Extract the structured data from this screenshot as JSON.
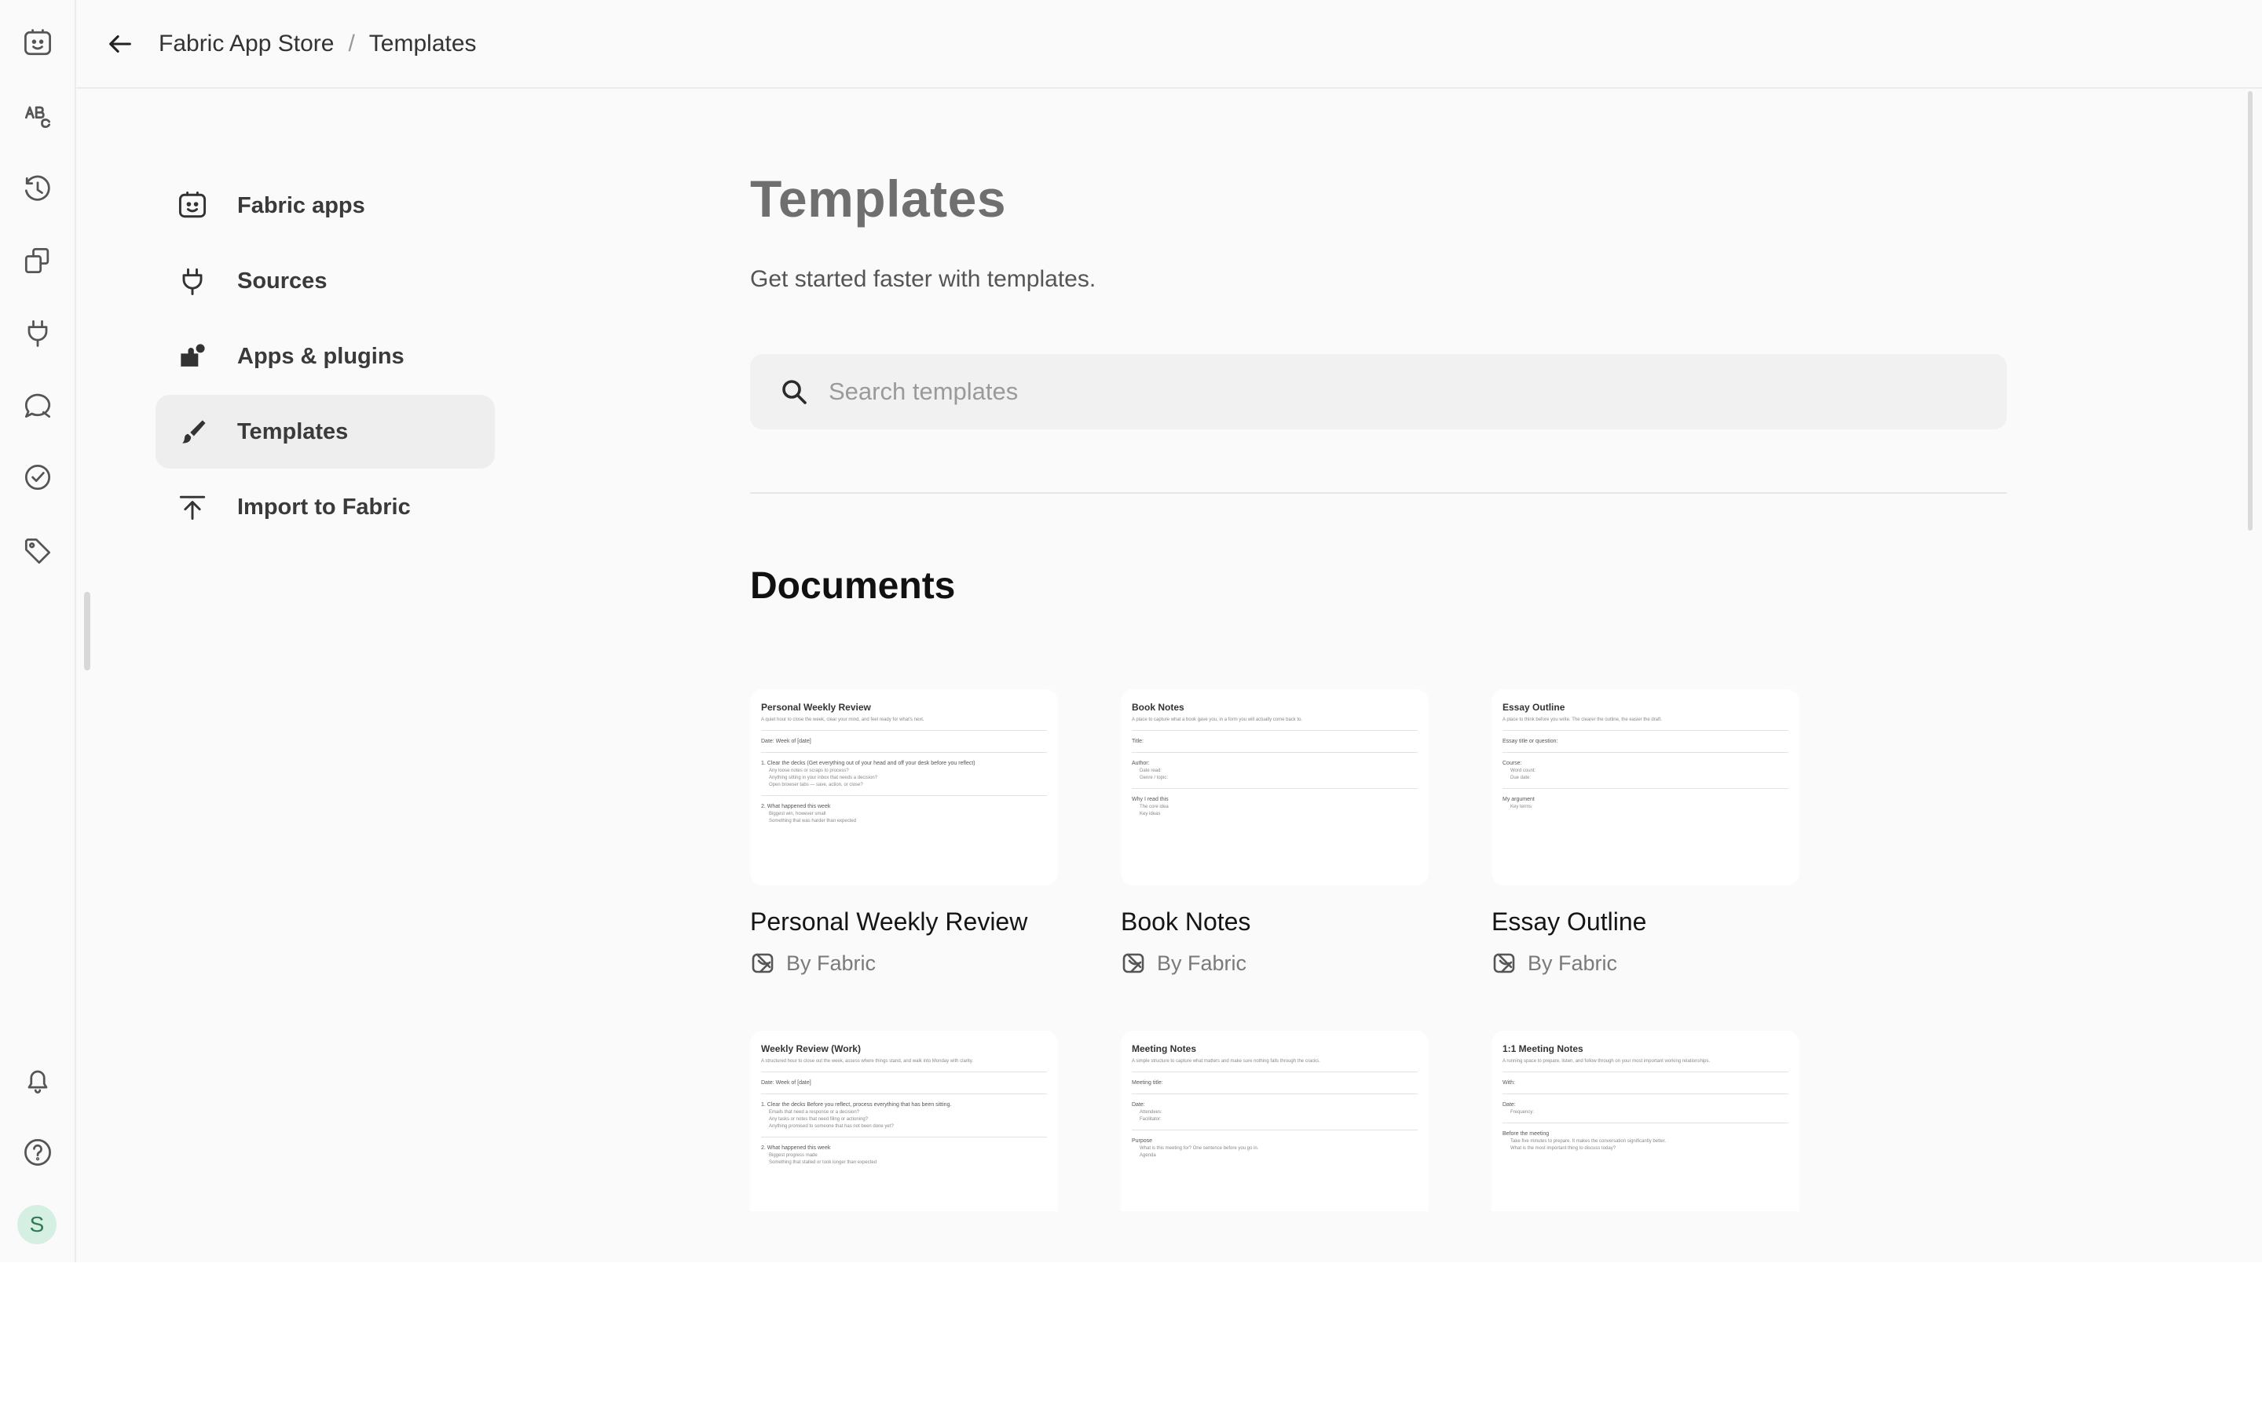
{
  "breadcrumb": {
    "parent": "Fabric App Store",
    "separator": "/",
    "current": "Templates"
  },
  "subnav": {
    "items": [
      {
        "label": "Fabric apps",
        "icon": "fabric-face-icon"
      },
      {
        "label": "Sources",
        "icon": "plug-icon"
      },
      {
        "label": "Apps & plugins",
        "icon": "apps-plugins-icon"
      },
      {
        "label": "Templates",
        "icon": "brush-icon",
        "active": true
      },
      {
        "label": "Import to Fabric",
        "icon": "upload-icon"
      }
    ]
  },
  "main": {
    "title": "Templates",
    "subtitle": "Get started faster with templates.",
    "search_placeholder": "Search templates",
    "section_title": "Documents"
  },
  "cards": [
    {
      "title": "Personal Weekly Review",
      "by": "By Fabric",
      "thumb": {
        "title": "Personal Weekly Review",
        "desc": "A quiet hour to close the week, clear your mind, and feel ready for what's next.",
        "row1": "Date: Week of [date]",
        "row2": "1. Clear the decks (Get everything out of your head and off your desk before you reflect)",
        "b1": "Any loose notes or scraps to process?",
        "b2": "Anything sitting in your inbox that needs a decision?",
        "b3": "Open browser tabs — save, action, or close?",
        "row3": "2. What happened this week",
        "b4": "Biggest win, however small",
        "b5": "Something that was harder than expected"
      }
    },
    {
      "title": "Book Notes",
      "by": "By Fabric",
      "thumb": {
        "title": "Book Notes",
        "desc": "A place to capture what a book gave you, in a form you will actually come back to.",
        "row1": "Title:",
        "row2": "Author:",
        "b1": "Date read:",
        "b2": "Genre / topic:",
        "b3": "",
        "row3": "Why I read this",
        "b4": "The core idea",
        "b5": "Key ideas"
      }
    },
    {
      "title": "Essay Outline",
      "by": "By Fabric",
      "thumb": {
        "title": "Essay Outline",
        "desc": "A place to think before you write. The clearer the outline, the easier the draft.",
        "row1": "Essay title or question:",
        "row2": "Course:",
        "b1": "Word count:",
        "b2": "Due date:",
        "b3": "",
        "row3": "My argument",
        "b4": "Key terms",
        "b5": ""
      }
    },
    {
      "title": "Weekly Review (Work)",
      "by": "By Fabric",
      "thumb": {
        "title": "Weekly Review (Work)",
        "desc": "A structured hour to close out the week, assess where things stand, and walk into Monday with clarity.",
        "row1": "Date: Week of [date]",
        "row2": "1. Clear the decks Before you reflect, process everything that has been sitting.",
        "b1": "Emails that need a response or a decision?",
        "b2": "Any tasks or notes that need filing or actioning?",
        "b3": "Anything promised to someone that has not been done yet?",
        "row3": "2. What happened this week",
        "b4": "Biggest progress made",
        "b5": "Something that stalled or took longer than expected"
      }
    },
    {
      "title": "Meeting Notes",
      "by": "By Fabric",
      "thumb": {
        "title": "Meeting Notes",
        "desc": "A simple structure to capture what matters and make sure nothing falls through the cracks.",
        "row1": "Meeting title:",
        "row2": "Date:",
        "b1": "Attendees:",
        "b2": "Facilitator:",
        "b3": "",
        "row3": "Purpose",
        "b4": "What is this meeting for? One sentence before you go in.",
        "b5": "Agenda"
      }
    },
    {
      "title": "1:1 Meeting Notes",
      "by": "By Fabric",
      "thumb": {
        "title": "1:1 Meeting Notes",
        "desc": "A running space to prepare, listen, and follow through on your most important working relationships.",
        "row1": "With:",
        "row2": "Date:",
        "b1": "Frequency:",
        "b2": "",
        "b3": "",
        "row3": "Before the meeting",
        "b4": "Take five minutes to prepare. It makes the conversation significantly better.",
        "b5": "What is the most important thing to discuss today?"
      }
    }
  ],
  "rail": {
    "icons": [
      "fabric-face-icon",
      "text-abc-icon",
      "history-icon",
      "collections-icon",
      "plug-icon",
      "chat-icon",
      "check-circle-icon",
      "tag-icon",
      "bell-icon",
      "help-icon"
    ],
    "avatar_letter": "S"
  },
  "colors": {
    "accent_avatar_bg": "#d6efe3",
    "avatar_fg": "#2f7a52",
    "active_item_bg": "#eeeeee"
  }
}
